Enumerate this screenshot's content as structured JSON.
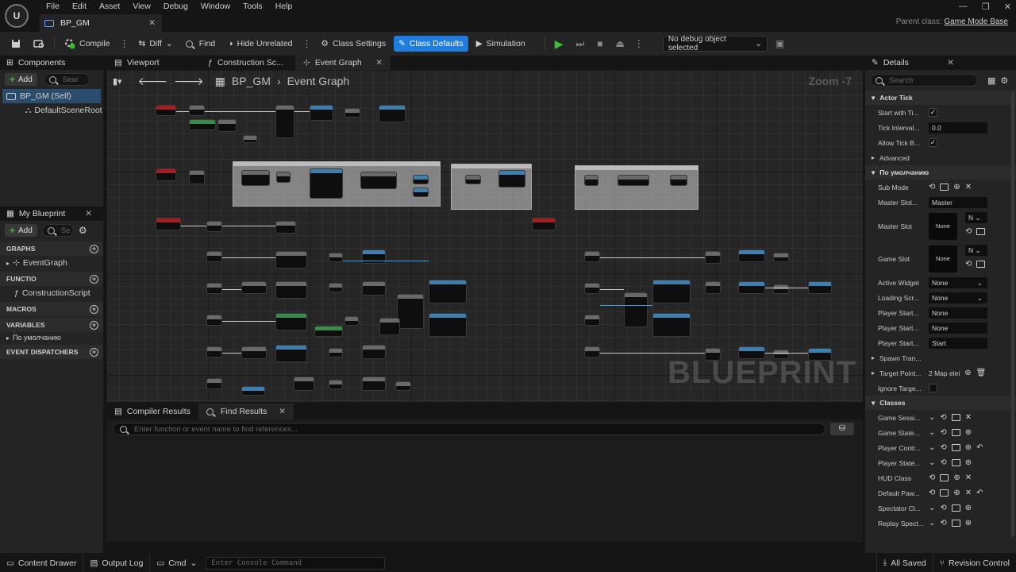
{
  "menu": [
    "File",
    "Edit",
    "Asset",
    "View",
    "Debug",
    "Window",
    "Tools",
    "Help"
  ],
  "document_tab": "BP_GM",
  "parent_class": {
    "label": "Parent class:",
    "value": "Game Mode Base"
  },
  "toolbar": {
    "compile": "Compile",
    "diff": "Diff",
    "find": "Find",
    "hide_unrelated": "Hide Unrelated",
    "class_settings": "Class Settings",
    "class_defaults": "Class Defaults",
    "simulation": "Simulation",
    "debug_object": "No debug object selected"
  },
  "components": {
    "title": "Components",
    "add": "Add",
    "search_placeholder": "Sear",
    "root": "BP_GM (Self)",
    "child": "DefaultSceneRoot"
  },
  "my_blueprint": {
    "title": "My Blueprint",
    "add": "Add",
    "search_placeholder": "Se",
    "sections": {
      "graphs": "GRAPHS",
      "event_graph": "EventGraph",
      "functions": "FUNCTIO",
      "construction_script": "ConstructionScript",
      "macros": "MACROS",
      "variables": "VARIABLES",
      "default_category": "По умолчанию",
      "event_dispatchers": "EVENT DISPATCHERS"
    }
  },
  "graph_tabs": [
    "Viewport",
    "Construction Sc...",
    "Event Graph"
  ],
  "graph": {
    "breadcrumb_root": "BP_GM",
    "breadcrumb_graph": "Event Graph",
    "zoom": "Zoom -7",
    "watermark": "BLUEPRINT"
  },
  "bottom": {
    "tabs": [
      "Compiler Results",
      "Find Results"
    ],
    "find_placeholder": "Enter function or event name to find references..."
  },
  "details": {
    "title": "Details",
    "search_placeholder": "Search",
    "actor_tick": "Actor Tick",
    "start_with_tick": "Start with Ti...",
    "tick_interval": "Tick Interval...",
    "tick_interval_value": "0.0",
    "allow_tick": "Allow Tick B...",
    "advanced": "Advanced",
    "default_section": "По умолчанию",
    "sub_mode": "Sub Mode",
    "master_slot_1": "Master Slot...",
    "master_slot_1_value": "Master",
    "master_slot": "Master Slot",
    "master_slot_none": "None",
    "n_select": "N",
    "game_slot": "Game Slot",
    "game_slot_none": "None",
    "active_widget": "Active Widget",
    "active_widget_value": "None",
    "loading_screen": "Loading Scr...",
    "loading_screen_value": "None",
    "player_start_1": "Player Start...",
    "player_start_1_value": "None",
    "player_start_2": "Player Start...",
    "player_start_2_value": "None",
    "player_start_3": "Player Start...",
    "player_start_3_value": "Start",
    "spawn_transform": "Spawn Tran...",
    "target_points": "Target Point...",
    "target_points_value": "2 Map elei",
    "ignore_target": "Ignore Targe...",
    "classes": "Classes",
    "game_session": "Game Sessi...",
    "game_state": "Game State...",
    "player_controller": "Player Contr...",
    "player_state": "Player State...",
    "hud_class": "HUD Class",
    "default_pawn": "Default Paw...",
    "spectator_class": "Spectator Cl...",
    "replay_spectator": "Replay Spect..."
  },
  "statusbar": {
    "content_drawer": "Content Drawer",
    "output_log": "Output Log",
    "cmd": "Cmd",
    "console_placeholder": "Enter Console Command",
    "all_saved": "All Saved",
    "revision_control": "Revision Control"
  }
}
